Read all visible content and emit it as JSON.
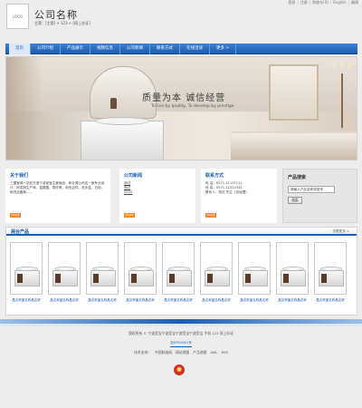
{
  "topbar": {
    "login": "登录",
    "register": "注册",
    "shop": "购物车(0)",
    "lang1": "English",
    "lang2": "编辑"
  },
  "header": {
    "logo": "LOGO",
    "company_name": "公司名称",
    "company_sub": "主营：[主营] + 123 + [网上办证]"
  },
  "nav": {
    "items": [
      "首页",
      "公司介绍",
      "产品展示",
      "视频信息",
      "公司新闻",
      "联系方式",
      "在线洽谈",
      "更多 >"
    ]
  },
  "banner": {
    "slogan": "质量为本  诚信经营",
    "slogan_en": "To live by quality, To develop by prestige"
  },
  "about": {
    "title": "关于我们",
    "text": "三图室城一站在打造宁波室宝主营商品，和业源公司名一家专业设计，研发制生产商，温泉圆、零件等、和洗浴件、洗手盆，日用，和洗浴器具……",
    "more": "MORE"
  },
  "news": {
    "title": "公司新闻",
    "items": [
      "测试",
      "测试",
      "5555"
    ],
    "more": "MORE"
  },
  "contact": {
    "title": "联系方式",
    "phone": "电 话：0571-11111111",
    "fax": "传 真：0571-12312345",
    "person": "联系人：测试 先生（总经理）",
    "more": "MORE"
  },
  "search": {
    "title": "产品搜索",
    "placeholder": "请输入产品名称或型号",
    "button": "搜索"
  },
  "products": {
    "title": "展台产品",
    "more": "查看更多 >",
    "items": [
      "晶名称晶名称晶名称",
      "晶名称晶名称晶名称",
      "晶名称晶名称晶名称",
      "晶名称晶名称晶名称",
      "晶名称晶名称晶名称",
      "晶名称晶名称晶名称",
      "晶名称晶名称晶名称",
      "晶名称晶名称晶名称",
      "晶名称晶名称晶名称"
    ]
  },
  "footer": {
    "copyright": "版权所有 © 宁波室宝宁波室宝宁波室宝宁波室宝  手机  123  网上办证",
    "icp": "浙ICP00001号",
    "support_label": "技术支持：",
    "links": [
      "中国制造网",
      "网站地图",
      "产品地图",
      "XML",
      "RSS"
    ]
  }
}
